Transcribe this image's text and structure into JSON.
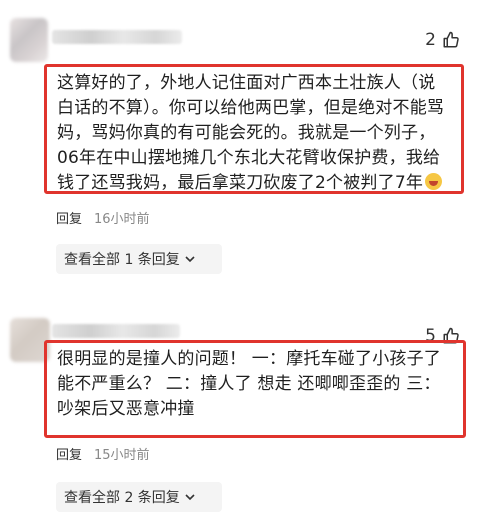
{
  "comments": [
    {
      "likes": "2",
      "text": "这算好的了，外地人记住面对广西本土壮族人（说白话的不算）。你可以给他两巴掌，但是绝对不能骂妈，骂妈你真的有可能会死的。我就是一个列子，06年在中山摆地摊几个东北大花臂收保护费，我给钱了还骂我妈，最后拿菜刀砍废了2个被判了7年",
      "reply_label": "回复",
      "time": "16小时前",
      "view_replies": "查看全部 1 条回复"
    },
    {
      "likes": "5",
      "text": "很明显的是撞人的问题！ 一：摩托车碰了小孩子了 能不严重么？ 二：撞人了 想走 还唧唧歪歪的 三：吵架后又恶意冲撞",
      "reply_label": "回复",
      "time": "15小时前",
      "view_replies": "查看全部 2 条回复"
    }
  ],
  "icons": {
    "like": "thumbs-up-icon",
    "expand": "chevron-down-icon",
    "emoji": "laughing-tears-emoji-icon"
  },
  "colors": {
    "highlight_border": "#e0342d"
  }
}
